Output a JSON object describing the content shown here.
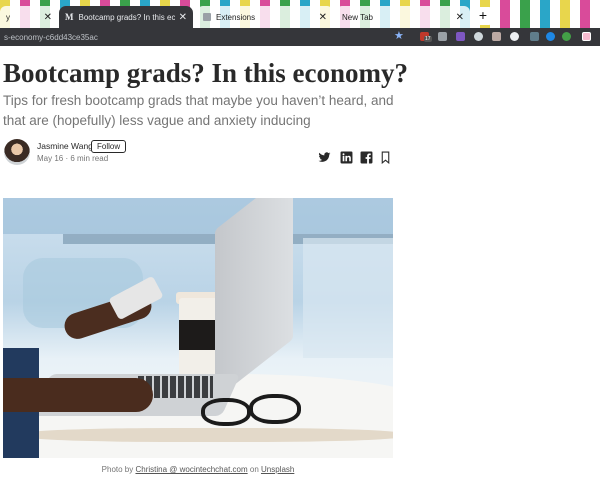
{
  "browser": {
    "tabs": [
      {
        "label": "y",
        "active": false
      },
      {
        "label": "Bootcamp grads? In this econo",
        "active": true,
        "favicon": "M"
      },
      {
        "label": "Extensions",
        "active": false
      },
      {
        "label": "New Tab",
        "active": false
      }
    ],
    "new_tab_symbol": "+",
    "close_symbol": "✕",
    "url": "s-economy-c6dd43ce35ac",
    "bookmark_icon": "star-icon",
    "extension_badge": "17"
  },
  "article": {
    "title": "Bootcamp grads? In this economy?",
    "subtitle": "Tips for fresh bootcamp grads that maybe you haven’t heard, and that are (hopefully) less vague and anxiety inducing",
    "author": {
      "name": "Jasmine Wang",
      "follow_label": "Follow",
      "meta": "May 16 · 6 min read"
    },
    "share_icons": [
      "twitter-icon",
      "linkedin-icon",
      "facebook-icon",
      "bookmark-icon"
    ],
    "image_caption": {
      "prefix": "Photo by ",
      "author_link": "Christina @ wocintechchat.com",
      "middle": " on ",
      "source_link": "Unsplash"
    }
  },
  "colors": {
    "tab_active_bg": "#35363a",
    "text_primary": "#292929",
    "text_secondary": "#757575"
  }
}
